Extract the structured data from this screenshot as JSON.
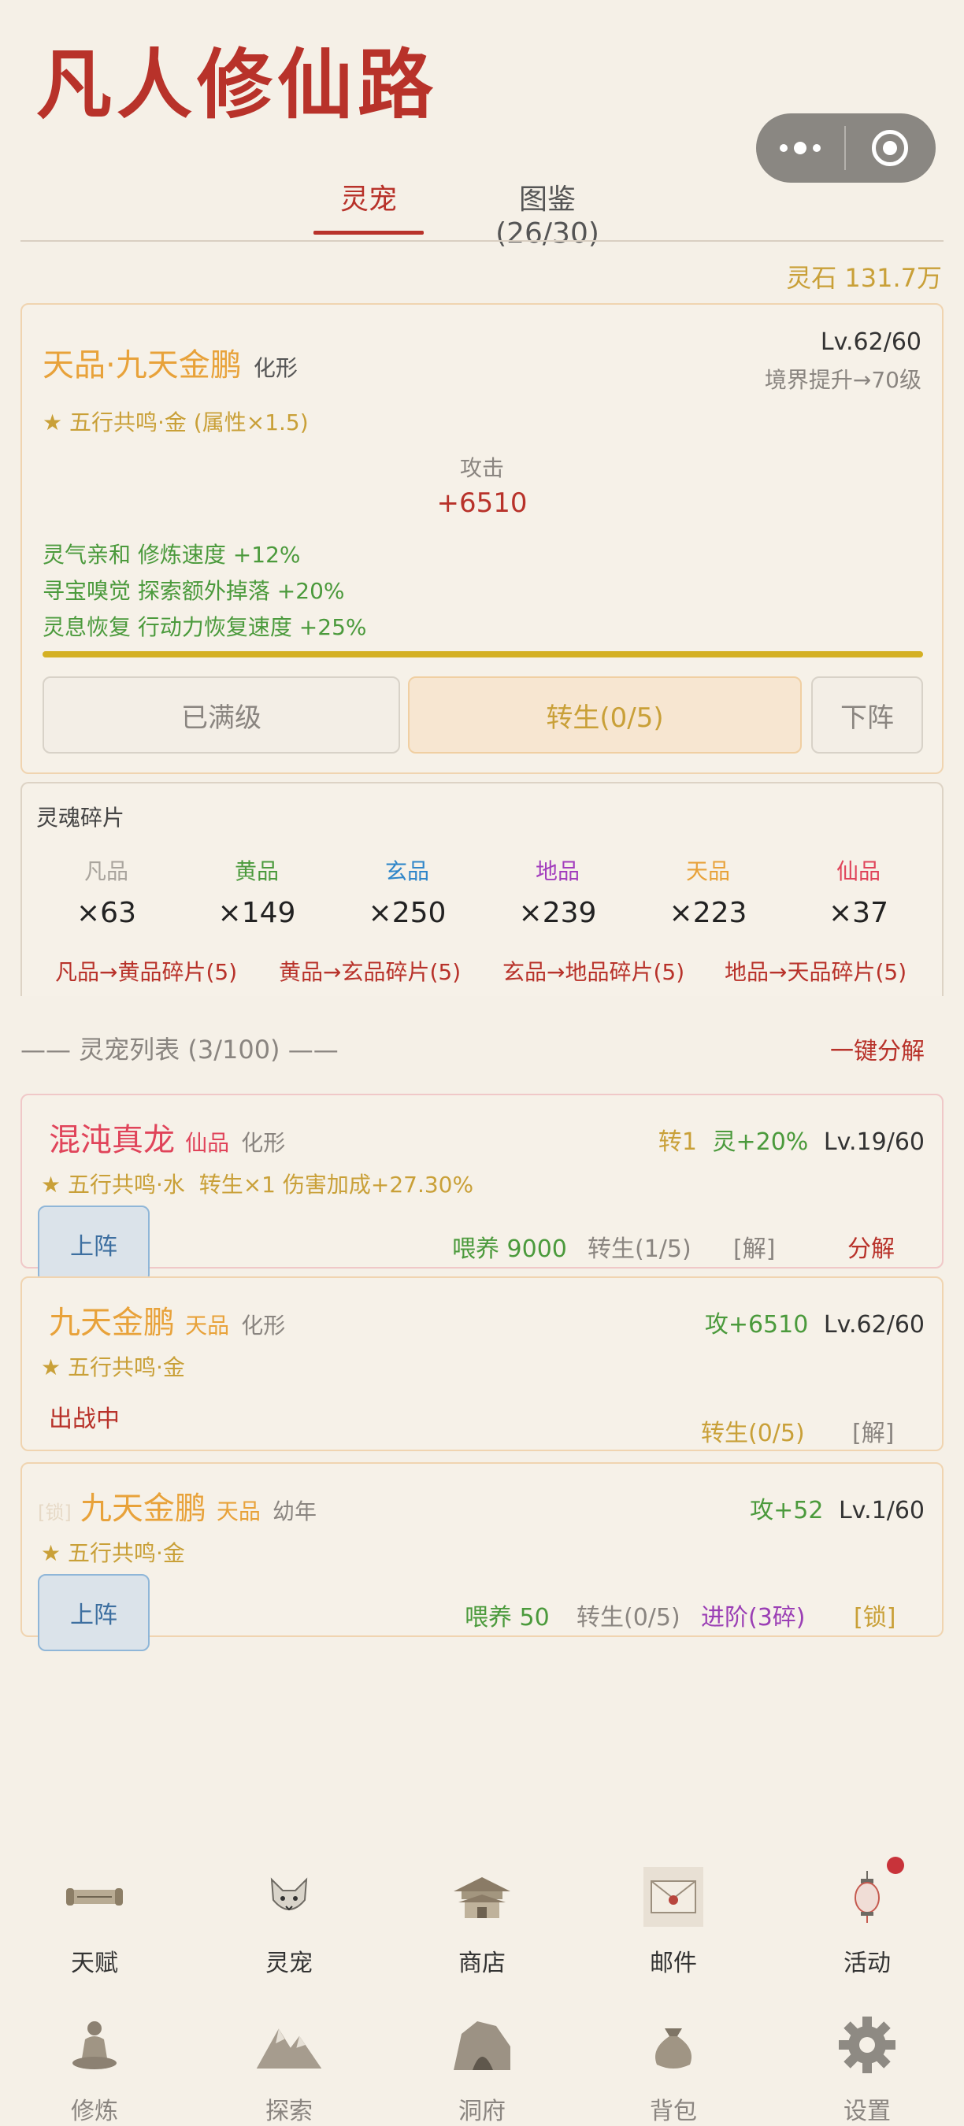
{
  "app": {
    "title": "凡人修仙路"
  },
  "tabs": [
    {
      "label": "灵宠",
      "active": true
    },
    {
      "label": "图鉴 (26/30)",
      "active": false
    }
  ],
  "currency": {
    "label": "灵石 131.7万"
  },
  "pet": {
    "name": "天品·九天金鹏",
    "form": "化形",
    "level": "Lv.62/60",
    "breakthrough": "境界提升→70级",
    "resonance": "★ 五行共鸣·金 (属性×1.5)",
    "stat_label": "攻击",
    "stat_value": "+6510",
    "bonuses": [
      "灵气亲和 修炼速度 +12%",
      "寻宝嗅觉 探索额外掉落 +20%",
      "灵息恢复 行动力恢复速度 +25%"
    ],
    "progress": 1.0,
    "buttons": {
      "maxed": "已满级",
      "rebirth": "转生(0/5)",
      "unequip": "下阵"
    }
  },
  "fragments": {
    "title": "灵魂碎片",
    "items": [
      {
        "quality": "凡品",
        "count": "×63",
        "color": "#a9a49d"
      },
      {
        "quality": "黄品",
        "count": "×149",
        "color": "#4b9a3c"
      },
      {
        "quality": "玄品",
        "count": "×250",
        "color": "#2f86c9"
      },
      {
        "quality": "地品",
        "count": "×239",
        "color": "#a23dbd"
      },
      {
        "quality": "天品",
        "count": "×223",
        "color": "#e8a23a"
      },
      {
        "quality": "仙品",
        "count": "×37",
        "color": "#e0445a"
      }
    ],
    "conversions": [
      "凡品→黄品碎片(5)",
      "黄品→玄品碎片(5)",
      "玄品→地品碎片(5)",
      "地品→天品碎片(5)"
    ]
  },
  "list": {
    "title": "—— 灵宠列表 (3/100) ——",
    "decompose_all": "一键分解",
    "rows": [
      {
        "name": "混沌真龙",
        "quality": "仙品",
        "stage": "化形",
        "rebirth_tag": "转1",
        "spirit": "灵+20%",
        "level": "Lv.19/60",
        "resonance": "★ 五行共鸣·水  转生×1 伤害加成+27.30%",
        "equip": "上阵",
        "feed": "喂养 9000",
        "rebirth": "转生(1/5)",
        "unlock": "[解]",
        "decompose": "分解"
      },
      {
        "name": "九天金鹏",
        "quality": "天品",
        "stage": "化形",
        "attack": "攻+6510",
        "level": "Lv.62/60",
        "resonance": "★ 五行共鸣·金",
        "status": "出战中",
        "rebirth": "转生(0/5)",
        "unlock": "[解]"
      },
      {
        "lock_tag": "[锁]",
        "name": "九天金鹏",
        "quality": "天品",
        "stage": "幼年",
        "attack": "攻+52",
        "level": "Lv.1/60",
        "resonance": "★ 五行共鸣·金",
        "equip": "上阵",
        "feed": "喂养 50",
        "rebirth": "转生(0/5)",
        "advance": "进阶(3碎)",
        "lock": "[锁]"
      }
    ]
  },
  "nav": {
    "row1": [
      {
        "label": "天赋",
        "icon": "scroll-icon"
      },
      {
        "label": "灵宠",
        "icon": "fox-icon"
      },
      {
        "label": "商店",
        "icon": "pavilion-icon"
      },
      {
        "label": "邮件",
        "icon": "envelope-icon"
      },
      {
        "label": "活动",
        "icon": "lantern-icon",
        "badge": true
      }
    ],
    "row2": [
      {
        "label": "修炼",
        "icon": "meditation-icon"
      },
      {
        "label": "探索",
        "icon": "mountain-icon"
      },
      {
        "label": "洞府",
        "icon": "cave-icon"
      },
      {
        "label": "背包",
        "icon": "pouch-icon"
      },
      {
        "label": "设置",
        "icon": "gear-icon"
      }
    ]
  }
}
